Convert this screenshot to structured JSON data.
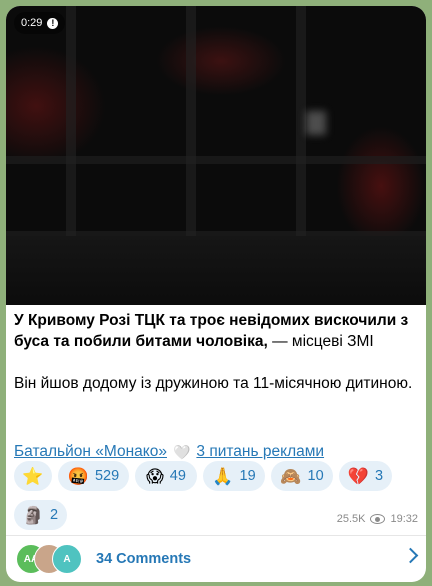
{
  "video": {
    "duration": "0:29",
    "mute_icon": "!"
  },
  "post": {
    "title_bold": "У Кривому Розі ТЦК та троє невідомих вискочили з буса та побили битами чоловіка,",
    "title_rest": " — місцеві ЗМІ",
    "body": "Він йшов додому із дружиною та 11-місячною дитиною."
  },
  "links": {
    "channel": "Батальйон «Монако»",
    "ads": "3 питань реклами",
    "heart": "🤍"
  },
  "reactions": [
    {
      "emoji": "⭐",
      "count": ""
    },
    {
      "emoji": "🤬",
      "count": "529"
    },
    {
      "emoji": "😱",
      "count": "49"
    },
    {
      "emoji": "🙏",
      "count": "19"
    },
    {
      "emoji": "🙈",
      "count": "10"
    },
    {
      "emoji": "💔",
      "count": "3"
    },
    {
      "emoji": "🗿",
      "count": "2"
    }
  ],
  "meta": {
    "views": "25.5K",
    "time": "19:32"
  },
  "comments": {
    "label": "34 Comments",
    "avatars": [
      "AA",
      "",
      "A"
    ]
  },
  "colors": {
    "link": "#2678b6",
    "reaction_bg": "#e6f0f8",
    "background": "#8fb07a"
  }
}
